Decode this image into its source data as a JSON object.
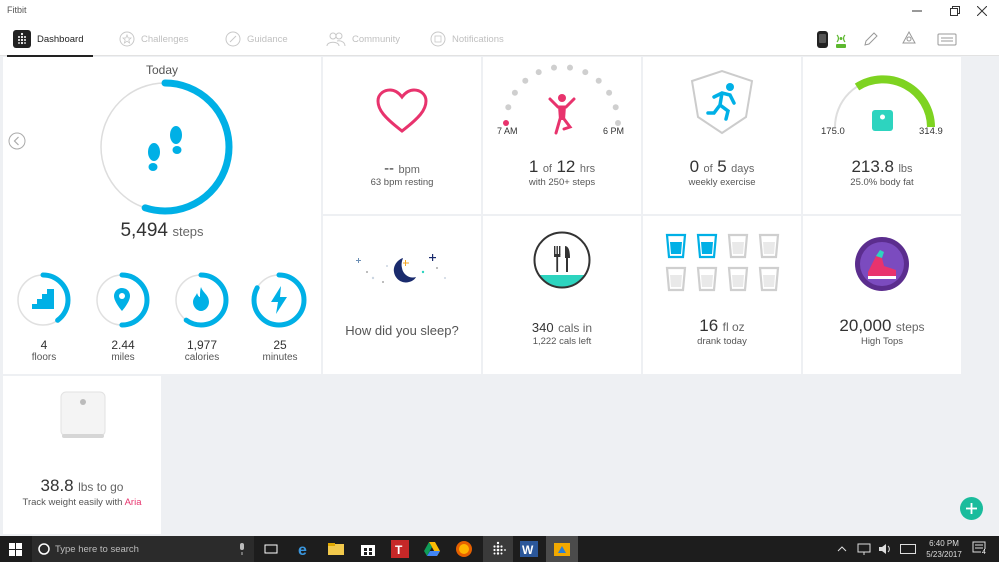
{
  "window": {
    "title": "Fitbit"
  },
  "nav": {
    "tabs": [
      {
        "label": "Dashboard"
      },
      {
        "label": "Challenges"
      },
      {
        "label": "Guidance"
      },
      {
        "label": "Community"
      },
      {
        "label": "Notifications"
      }
    ]
  },
  "steps": {
    "today_label": "Today",
    "value": "5,494",
    "unit": "steps",
    "progress": 0.55
  },
  "stats": [
    {
      "value": "4",
      "label": "floors",
      "progress": 0.4
    },
    {
      "value": "2.44",
      "label": "miles",
      "progress": 0.5
    },
    {
      "value": "1,977",
      "label": "calories",
      "progress": 0.6
    },
    {
      "value": "25",
      "label": "minutes",
      "progress": 0.83
    }
  ],
  "heart": {
    "value": "--",
    "unit": "bpm",
    "resting": "63 bpm resting"
  },
  "hourly": {
    "start": "7 AM",
    "end": "6 PM",
    "value": "1",
    "of": "of",
    "goal": "12",
    "unit": "hrs",
    "note": "with 250+ steps"
  },
  "exercise": {
    "value": "0",
    "of": "of",
    "goal": "5",
    "unit": "days",
    "note": "weekly exercise"
  },
  "weight": {
    "min": "175.0",
    "max": "314.9",
    "value": "213.8",
    "unit": "lbs",
    "note": "25.0% body fat"
  },
  "sleep": {
    "prompt": "How did you sleep?"
  },
  "food": {
    "value": "340",
    "unit": "cals in",
    "note": "1,222 cals left"
  },
  "water": {
    "value": "16",
    "unit": "fl oz",
    "note": "drank today",
    "glasses_filled": 2,
    "glasses_total": 8
  },
  "badge": {
    "value": "20,000",
    "unit": "steps",
    "note": "High Tops"
  },
  "aria": {
    "value": "38.8",
    "unit": "lbs to go",
    "note_prefix": "Track weight easily with ",
    "note_link": "Aria"
  },
  "taskbar": {
    "search_placeholder": "Type here to search",
    "time": "6:40 PM",
    "date": "5/23/2017",
    "notification_count": "4"
  },
  "colors": {
    "accent": "#00b0e6",
    "pink": "#e8336d",
    "teal": "#2dd4bf",
    "green": "#7ed321",
    "fab": "#1abc9c"
  }
}
